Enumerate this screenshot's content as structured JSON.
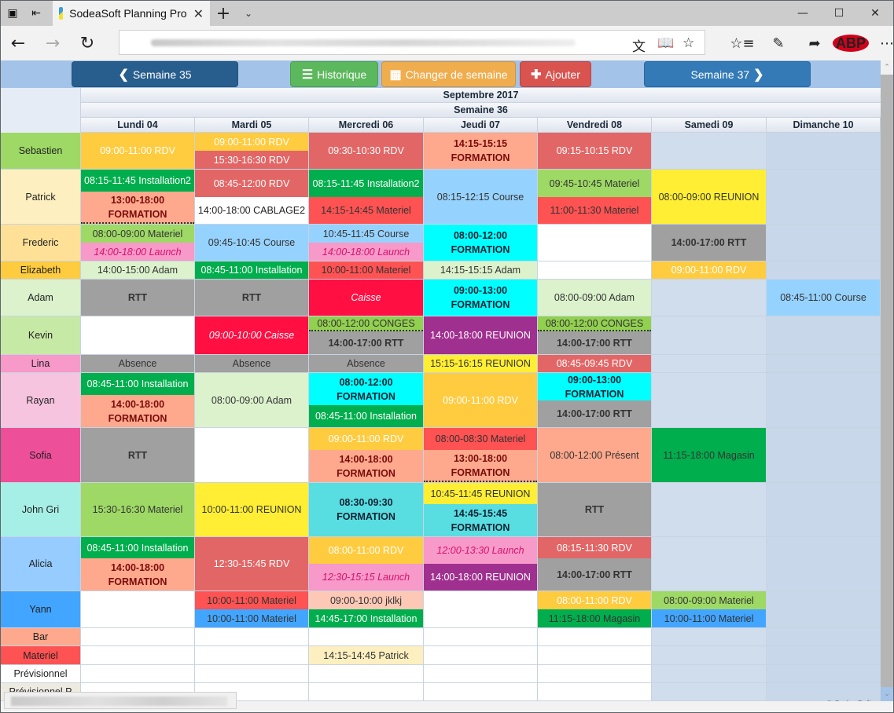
{
  "browser": {
    "tab_title": "SodeaSoft Planning Pro",
    "icons": {
      "tab_manager": "tabs-icon",
      "set_aside": "set-aside-tabs-icon",
      "close_tab": "close-icon",
      "new_tab": "plus-icon",
      "tab_menu": "chevron-down-icon",
      "back": "back-arrow-icon",
      "forward": "forward-arrow-icon",
      "refresh": "refresh-icon",
      "translate": "translate-icon",
      "reading_view": "book-icon",
      "favorite": "star-icon",
      "favorites_hub": "favorites-list-icon",
      "notes": "pen-icon",
      "share": "share-icon",
      "adblock": "abp-icon",
      "more": "more-icon"
    },
    "adblock_label": "ABP"
  },
  "toolbar": {
    "prev_week": "Semaine 35",
    "history": "Historique",
    "change_week": "Changer de semaine",
    "add": "Ajouter",
    "next_week": "Semaine 37",
    "colors": {
      "prev": "#285e8e",
      "history": "#5cb85c",
      "change": "#f0ad4e",
      "add": "#d9534f",
      "next": "#337ab7"
    }
  },
  "calendar": {
    "month": "Septembre 2017",
    "week": "Semaine 36",
    "days": [
      "Lundi 04",
      "Mardi 05",
      "Mercredi 06",
      "Jeudi 07",
      "Vendredi 08",
      "Samedi 09",
      "Dimanche 10"
    ],
    "rows": [
      {
        "name": "Sebastien",
        "color": "#9ed966",
        "days": [
          [
            {
              "text": "09:00-11:00 RDV",
              "bg": "#ffcb3f",
              "fg": "#fff"
            }
          ],
          [
            {
              "text": "09:00-11:00 RDV",
              "bg": "#ffcb3f",
              "fg": "#fff"
            },
            {
              "text": "15:30-16:30 RDV",
              "bg": "#e26666",
              "fg": "#fff"
            }
          ],
          [
            {
              "text": "09:30-10:30 RDV",
              "bg": "#e26666",
              "fg": "#fff"
            }
          ],
          [
            {
              "text": "14:15-15:15 FORMATION",
              "bg": "#fea98d",
              "fg": "#7a0b0b",
              "bold": true
            }
          ],
          [
            {
              "text": "09:15-10:15 RDV",
              "bg": "#e26666",
              "fg": "#fff"
            }
          ],
          [],
          []
        ]
      },
      {
        "name": "Patrick",
        "color": "#feefc0",
        "days": [
          [
            {
              "text": "08:15-11:45 Installation2",
              "bg": "#00ae4d",
              "fg": "#fff"
            },
            {
              "text": "13:00-18:00 FORMATION",
              "bg": "#fea98d",
              "fg": "#7a0b0b",
              "bold": true,
              "dotted": true
            }
          ],
          [
            {
              "text": "08:45-12:00 RDV",
              "bg": "#e26666",
              "fg": "#fff"
            },
            {
              "text": "14:00-18:00 CABLAGE2",
              "bg": "#ffffff",
              "fg": "#222"
            }
          ],
          [
            {
              "text": "08:15-11:45 Installation2",
              "bg": "#00ae4d",
              "fg": "#fff"
            },
            {
              "text": "14:15-14:45 Materiel",
              "bg": "#ff5252",
              "fg": "#333"
            }
          ],
          [
            {
              "text": "08:15-12:15 Course",
              "bg": "#96d2fe",
              "fg": "#333"
            }
          ],
          [
            {
              "text": "09:45-10:45 Materiel",
              "bg": "#9ed966",
              "fg": "#333"
            },
            {
              "text": "11:00-11:30 Materiel",
              "bg": "#ff5252",
              "fg": "#333"
            }
          ],
          [
            {
              "text": "08:00-09:00 REUNION",
              "bg": "#ffee33",
              "fg": "#333"
            }
          ],
          []
        ]
      },
      {
        "name": "Frederic",
        "color": "#fee197",
        "days": [
          [
            {
              "text": "08:00-09:00 Materiel",
              "bg": "#9ed966",
              "fg": "#333"
            },
            {
              "text": "14:00-18:00 Launch",
              "bg": "#f799c9",
              "fg": "#d6136e",
              "italic": true
            }
          ],
          [
            {
              "text": "09:45-10:45 Course",
              "bg": "#96d2fe",
              "fg": "#333"
            }
          ],
          [
            {
              "text": "10:45-11:45 Course",
              "bg": "#96d2fe",
              "fg": "#333"
            },
            {
              "text": "14:00-18:00 Launch",
              "bg": "#f799c9",
              "fg": "#d6136e",
              "italic": true
            }
          ],
          [
            {
              "text": "08:00-12:00 FORMATION",
              "bg": "#00ffff",
              "fg": "#123",
              "bold": true
            }
          ],
          [],
          [
            {
              "text": "14:00-17:00 RTT",
              "bg": "#a0a0a0",
              "fg": "#333",
              "bold": true
            }
          ],
          []
        ]
      },
      {
        "name": "Elizabeth",
        "color": "#ffcb3f",
        "days": [
          [
            {
              "text": "14:00-15:00 Adam",
              "bg": "#dcf2cc",
              "fg": "#333"
            }
          ],
          [
            {
              "text": "08:45-11:00 Installation",
              "bg": "#00ae4d",
              "fg": "#fff"
            }
          ],
          [
            {
              "text": "10:00-11:00 Materiel",
              "bg": "#ff5252",
              "fg": "#333"
            }
          ],
          [
            {
              "text": "14:15-15:15 Adam",
              "bg": "#dcf2cc",
              "fg": "#333"
            }
          ],
          [],
          [
            {
              "text": "09:00-11:00 RDV",
              "bg": "#ffcb3f",
              "fg": "#fff"
            }
          ],
          []
        ]
      },
      {
        "name": "Adam",
        "color": "#dcf2cc",
        "days": [
          [
            {
              "text": "RTT",
              "bg": "#a0a0a0",
              "fg": "#333",
              "bold": true
            }
          ],
          [
            {
              "text": "RTT",
              "bg": "#a0a0a0",
              "fg": "#333",
              "bold": true
            }
          ],
          [
            {
              "text": "Caisse",
              "bg": "#ff0f42",
              "fg": "#fff",
              "italic": true
            }
          ],
          [
            {
              "text": "09:00-13:00 FORMATION",
              "bg": "#00ffff",
              "fg": "#123",
              "bold": true
            }
          ],
          [
            {
              "text": "08:00-09:00 Adam",
              "bg": "#dcf2cc",
              "fg": "#333"
            }
          ],
          [],
          [
            {
              "text": "08:45-11:00 Course",
              "bg": "#96d2fe",
              "fg": "#333"
            }
          ]
        ]
      },
      {
        "name": "Kevin",
        "color": "#c6eaa6",
        "days": [
          [],
          [
            {
              "text": "09:00-10:00 Caisse",
              "bg": "#ff0f42",
              "fg": "#fff",
              "italic": true
            }
          ],
          [
            {
              "text": "08:00-12:00 CONGES",
              "bg": "#92d050",
              "fg": "#333",
              "dotted": true
            },
            {
              "text": "14:00-17:00 RTT",
              "bg": "#a0a0a0",
              "fg": "#333",
              "bold": true
            }
          ],
          [
            {
              "text": "14:00-18:00 REUNION",
              "bg": "#a0308f",
              "fg": "#fff"
            }
          ],
          [
            {
              "text": "08:00-12:00 CONGES",
              "bg": "#92d050",
              "fg": "#333",
              "dotted": true
            },
            {
              "text": "14:00-17:00 RTT",
              "bg": "#a0a0a0",
              "fg": "#333",
              "bold": true
            }
          ],
          [],
          []
        ]
      },
      {
        "name": "Lina",
        "color": "#f799c9",
        "days": [
          [
            {
              "text": "Absence",
              "bg": "#a0a0a0",
              "fg": "#333"
            }
          ],
          [
            {
              "text": "Absence",
              "bg": "#a0a0a0",
              "fg": "#333"
            }
          ],
          [
            {
              "text": "Absence",
              "bg": "#a0a0a0",
              "fg": "#333"
            }
          ],
          [
            {
              "text": "15:15-16:15 REUNION",
              "bg": "#ffee33",
              "fg": "#333"
            }
          ],
          [
            {
              "text": "08:45-09:45 RDV",
              "bg": "#e26666",
              "fg": "#fff"
            }
          ],
          [],
          []
        ]
      },
      {
        "name": "Rayan",
        "color": "#f7c4e0",
        "days": [
          [
            {
              "text": "08:45-11:00 Installation",
              "bg": "#00ae4d",
              "fg": "#fff"
            },
            {
              "text": "14:00-18:00 FORMATION",
              "bg": "#fea98d",
              "fg": "#7a0b0b",
              "bold": true
            }
          ],
          [
            {
              "text": "08:00-09:00 Adam",
              "bg": "#dcf2cc",
              "fg": "#333"
            }
          ],
          [
            {
              "text": "08:00-12:00 FORMATION",
              "bg": "#00ffff",
              "fg": "#123",
              "bold": true
            },
            {
              "text": "08:45-11:00 Installation",
              "bg": "#00ae4d",
              "fg": "#fff"
            }
          ],
          [
            {
              "text": "09:00-11:00 RDV",
              "bg": "#ffcb3f",
              "fg": "#fff"
            }
          ],
          [
            {
              "text": "09:00-13:00 FORMATION",
              "bg": "#00ffff",
              "fg": "#123",
              "bold": true
            },
            {
              "text": "14:00-17:00 RTT",
              "bg": "#a0a0a0",
              "fg": "#333",
              "bold": true
            }
          ],
          [],
          []
        ]
      },
      {
        "name": "Sofia",
        "color": "#ee4f99",
        "days": [
          [
            {
              "text": "RTT",
              "bg": "#a0a0a0",
              "fg": "#333",
              "bold": true
            }
          ],
          [],
          [
            {
              "text": "09:00-11:00 RDV",
              "bg": "#ffcb3f",
              "fg": "#fff"
            },
            {
              "text": "14:00-18:00 FORMATION",
              "bg": "#fea98d",
              "fg": "#7a0b0b",
              "bold": true
            }
          ],
          [
            {
              "text": "08:00-08:30 Materiel",
              "bg": "#ff5252",
              "fg": "#333"
            },
            {
              "text": "13:00-18:00 FORMATION",
              "bg": "#fea98d",
              "fg": "#7a0b0b",
              "bold": true,
              "dotted": true
            }
          ],
          [
            {
              "text": "08:00-12:00 Présent",
              "bg": "#fea98d",
              "fg": "#333"
            }
          ],
          [
            {
              "text": "11:15-18:00 Magasin",
              "bg": "#00ae4d",
              "fg": "#333"
            }
          ],
          []
        ]
      },
      {
        "name": "John Gri",
        "color": "#a6efe6",
        "days": [
          [
            {
              "text": "15:30-16:30 Materiel",
              "bg": "#9ed966",
              "fg": "#333"
            }
          ],
          [
            {
              "text": "10:00-11:00 REUNION",
              "bg": "#ffee33",
              "fg": "#333"
            }
          ],
          [
            {
              "text": "08:30-09:30 FORMATION",
              "bg": "#58dde0",
              "fg": "#123",
              "bold": true
            }
          ],
          [
            {
              "text": "10:45-11:45 REUNION",
              "bg": "#ffee33",
              "fg": "#333"
            },
            {
              "text": "14:45-15:45 FORMATION",
              "bg": "#58dde0",
              "fg": "#123",
              "bold": true
            }
          ],
          [
            {
              "text": "RTT",
              "bg": "#a0a0a0",
              "fg": "#333",
              "bold": true
            }
          ],
          [],
          []
        ]
      },
      {
        "name": "Alicia",
        "color": "#96ccff",
        "days": [
          [
            {
              "text": "08:45-11:00 Installation",
              "bg": "#00ae4d",
              "fg": "#fff"
            },
            {
              "text": "14:00-18:00 FORMATION",
              "bg": "#fea98d",
              "fg": "#7a0b0b",
              "bold": true
            }
          ],
          [
            {
              "text": "12:30-15:45 RDV",
              "bg": "#e26666",
              "fg": "#fff"
            }
          ],
          [
            {
              "text": "08:00-11:00 RDV",
              "bg": "#ffcb3f",
              "fg": "#fff"
            },
            {
              "text": "12:30-15:15 Launch",
              "bg": "#f799c9",
              "fg": "#d6136e",
              "italic": true
            }
          ],
          [
            {
              "text": "12:00-13:30 Launch",
              "bg": "#f799c9",
              "fg": "#d6136e",
              "italic": true
            },
            {
              "text": "14:00-18:00 REUNION",
              "bg": "#a0308f",
              "fg": "#fff"
            }
          ],
          [
            {
              "text": "08:15-11:30 RDV",
              "bg": "#e26666",
              "fg": "#fff"
            },
            {
              "text": "14:00-17:00 RTT",
              "bg": "#a0a0a0",
              "fg": "#333",
              "bold": true
            }
          ],
          [],
          []
        ]
      },
      {
        "name": "Yann",
        "color": "#42a5ff",
        "days": [
          [],
          [
            {
              "text": "10:00-11:00 Materiel",
              "bg": "#ff5252",
              "fg": "#333"
            },
            {
              "text": "10:00-11:00 Materiel",
              "bg": "#42a5ff",
              "fg": "#333"
            }
          ],
          [
            {
              "text": "09:00-10:00 jklkj",
              "bg": "#fdc9b6",
              "fg": "#333"
            },
            {
              "text": "14:45-17:00 Installation",
              "bg": "#00ae4d",
              "fg": "#fff"
            }
          ],
          [],
          [
            {
              "text": "08:00-11:00 RDV",
              "bg": "#ffcb3f",
              "fg": "#fff"
            },
            {
              "text": "11:15-18:00 Magasin",
              "bg": "#00ae4d",
              "fg": "#333"
            }
          ],
          [
            {
              "text": "08:00-09:00 Materiel",
              "bg": "#9ed966",
              "fg": "#333"
            },
            {
              "text": "10:00-11:00 Materiel",
              "bg": "#42a5ff",
              "fg": "#333"
            }
          ],
          []
        ]
      },
      {
        "name": "Bar",
        "color": "#fea98d",
        "days": [
          [],
          [],
          [],
          [],
          [],
          [],
          []
        ]
      },
      {
        "name": "Materiel",
        "color": "#ff5252",
        "days": [
          [],
          [],
          [
            {
              "text": "14:15-14:45 Patrick",
              "bg": "#feefc0",
              "fg": "#333"
            }
          ],
          [],
          [],
          [],
          []
        ]
      },
      {
        "name": "Prévisionnel",
        "color": "#ffffff",
        "days": [
          [],
          [],
          [],
          [],
          [],
          [],
          []
        ]
      },
      {
        "name": "Prévisionnel P",
        "color": "#edeae0",
        "days": [
          [],
          [],
          [],
          [],
          [],
          [],
          []
        ]
      }
    ]
  },
  "footer": {
    "copyright": "© SodeaSoft"
  }
}
